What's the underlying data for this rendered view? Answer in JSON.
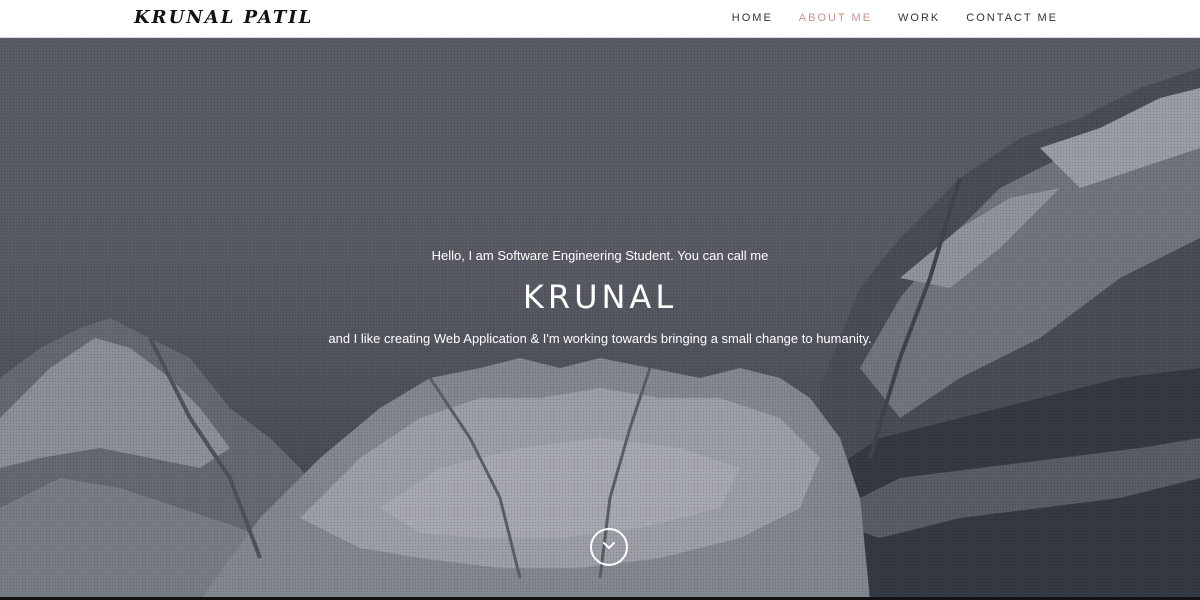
{
  "brand": "KRUNAL PATIL",
  "nav": {
    "items": [
      {
        "label": "HOME"
      },
      {
        "label": "ABOUT ME",
        "active": true
      },
      {
        "label": "WORK"
      },
      {
        "label": "CONTACT ME"
      }
    ]
  },
  "hero": {
    "intro": "Hello, I am Software Engineering Student. You can call me",
    "name": "KRUNAL",
    "tagline": "and I like creating Web Application & I'm working towards bringing a small change to humanity.",
    "scroll_icon": "chevron-down-icon"
  },
  "colors": {
    "nav_active": "#c9928a",
    "nav_text": "#333333",
    "hero_text": "#ffffff"
  }
}
